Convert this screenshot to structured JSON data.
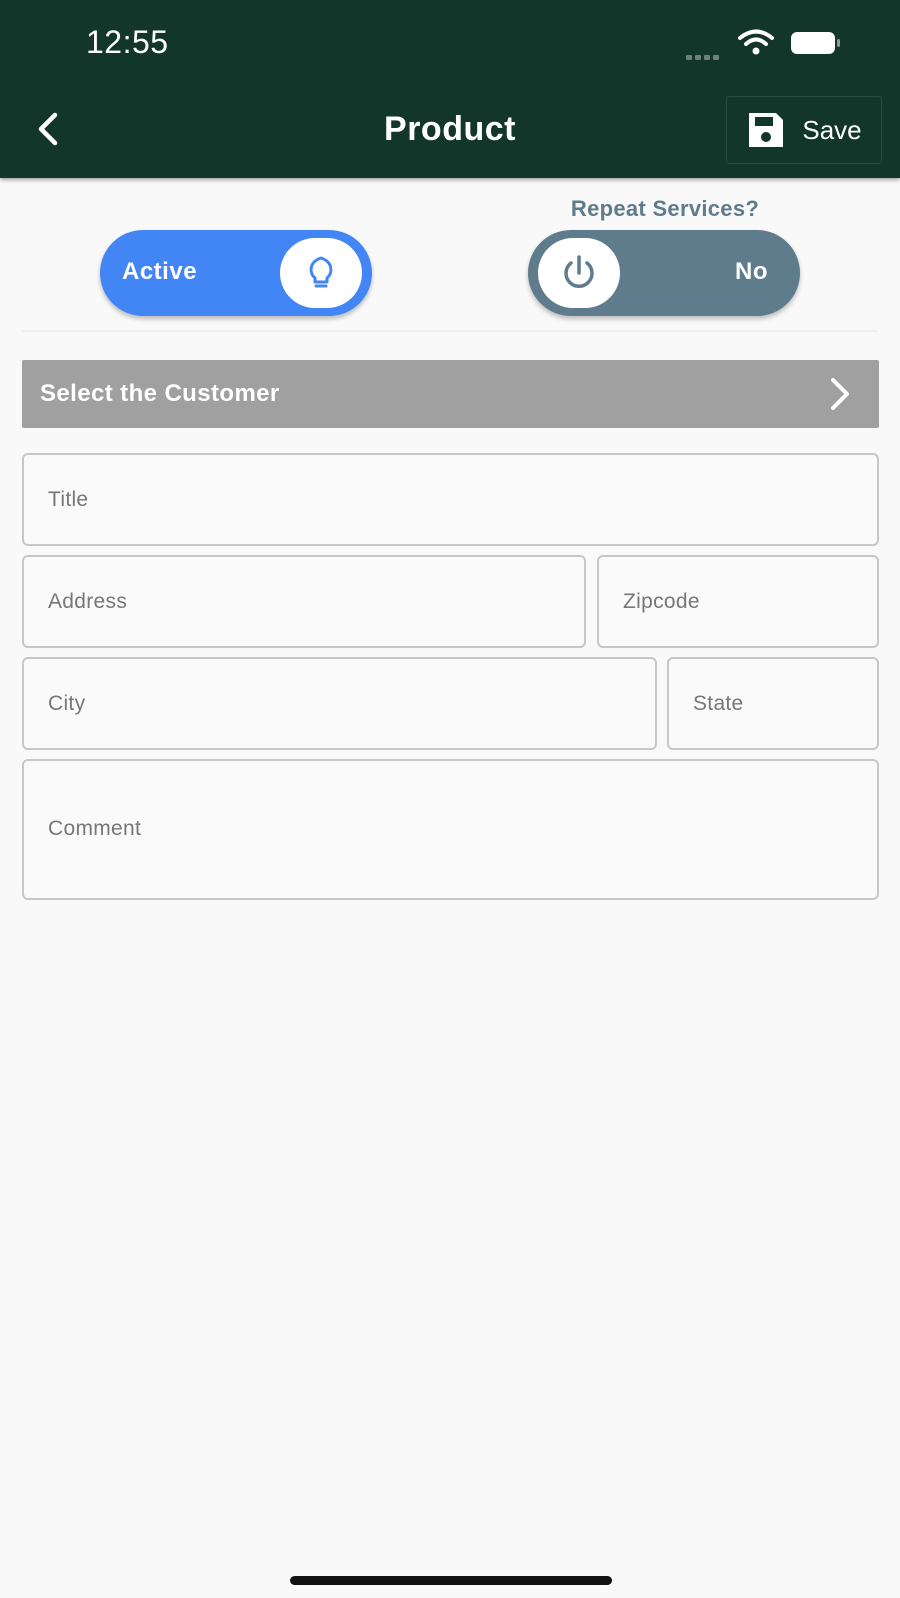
{
  "status_bar": {
    "time": "12:55"
  },
  "header": {
    "title": "Product",
    "save_label": "Save"
  },
  "toggles": {
    "active": {
      "label": "Active",
      "on": true,
      "color": "#4285f4"
    },
    "repeat": {
      "heading": "Repeat Services?",
      "label": "No",
      "on": false,
      "color": "#5f7c8c"
    }
  },
  "customer": {
    "label": "Select the Customer"
  },
  "form": {
    "title_placeholder": "Title",
    "address_placeholder": "Address",
    "zipcode_placeholder": "Zipcode",
    "city_placeholder": "City",
    "state_placeholder": "State",
    "comment_placeholder": "Comment"
  },
  "colors": {
    "appbar": "#12362a",
    "background": "#f9f9f9",
    "customer_bar": "#a0a0a0"
  }
}
